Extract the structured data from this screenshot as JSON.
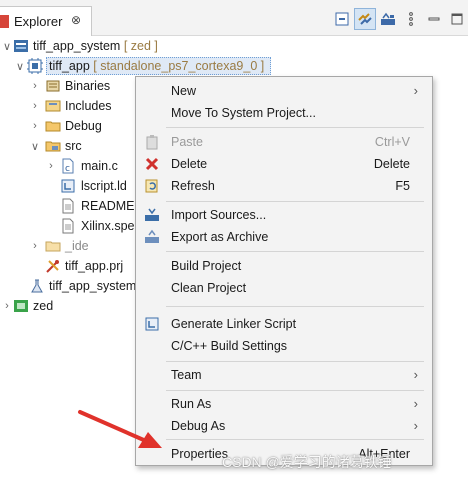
{
  "view": {
    "title": "Explorer",
    "close_glyph": "⊗",
    "toolbar": [
      {
        "icon": "collapse-all-icon"
      },
      {
        "icon": "link-with-editor-icon",
        "pressed": true
      },
      {
        "icon": "filter-icon"
      },
      {
        "icon": "view-menu-icon"
      },
      {
        "icon": "minimize-icon"
      },
      {
        "icon": "maximize-icon"
      }
    ]
  },
  "tree": {
    "system": {
      "name": "tiff_app_system",
      "decoration": "[ zed ]"
    },
    "app": {
      "name": "tiff_app",
      "decoration": "[ standalone_ps7_cortexa9_0 ]"
    },
    "binaries": "Binaries",
    "includes": "Includes",
    "debug": "Debug",
    "src": "src",
    "main_c": "main.c",
    "lscript": "lscript.ld",
    "readme": "README.",
    "xilinx_spec": "Xilinx.spe",
    "ide": "_ide",
    "prj": "tiff_app.prj",
    "system_prj": "tiff_app_system",
    "zed": "zed"
  },
  "menu": {
    "new": "New",
    "move": "Move To System Project...",
    "paste": "Paste",
    "paste_key": "Ctrl+V",
    "delete": "Delete",
    "delete_key": "Delete",
    "refresh": "Refresh",
    "refresh_key": "F5",
    "import_sources": "Import Sources...",
    "export_archive": "Export as Archive",
    "build": "Build Project",
    "clean": "Clean Project",
    "linker": "Generate Linker Script",
    "cbuild": "C/C++ Build Settings",
    "team": "Team",
    "run_as": "Run As",
    "debug_as": "Debug As",
    "properties": "Properties",
    "properties_key": "Alt+Enter",
    "submenu_glyph": "›"
  },
  "watermark": "CSDN @爱学习的诸葛铁锤",
  "colors": {
    "accent": "#2f6db5",
    "arrow": "#e0322b",
    "selection": "#dfe9f6"
  }
}
